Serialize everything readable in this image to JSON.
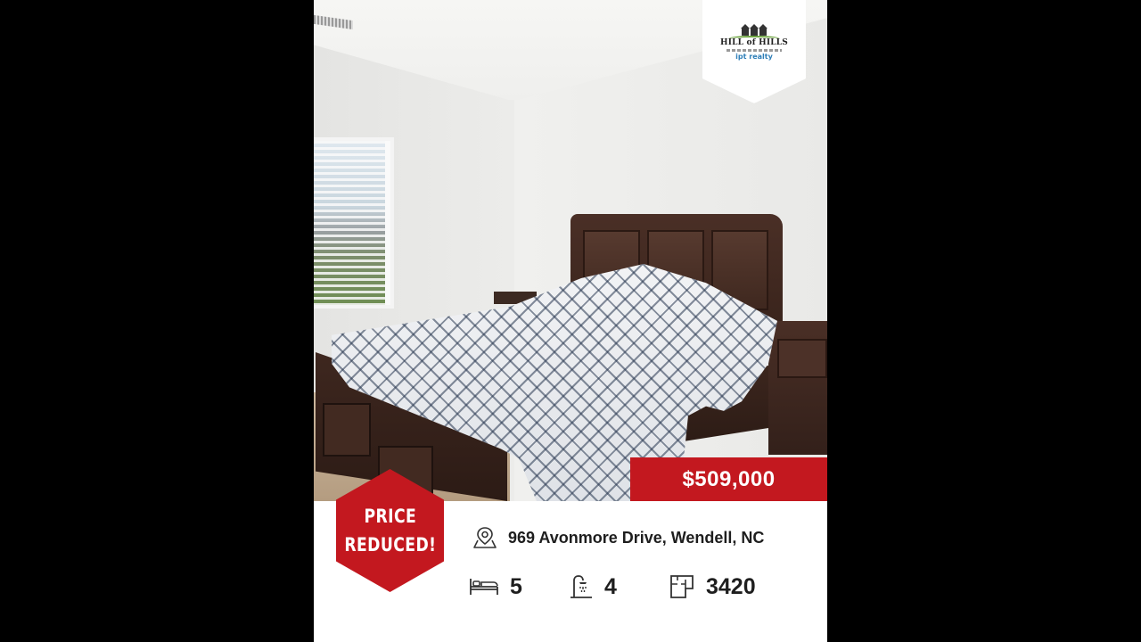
{
  "listing": {
    "price": "$509,000",
    "badge_lines": [
      "PRICE",
      "REDUCED!"
    ],
    "address": "969 Avonmore Drive, Wendell, NC",
    "beds": "5",
    "baths": "4",
    "sqft": "3420"
  },
  "brand": {
    "logo_name": "HILL of HILLS",
    "brokerage": "ipt realty"
  },
  "icons": {
    "address": "map-pin-icon",
    "beds": "bed-icon",
    "baths": "shower-icon",
    "sqft": "floorplan-icon"
  },
  "colors": {
    "accent_red": "#c3181f",
    "text_dark": "#1e1e1e",
    "background": "#000000"
  }
}
